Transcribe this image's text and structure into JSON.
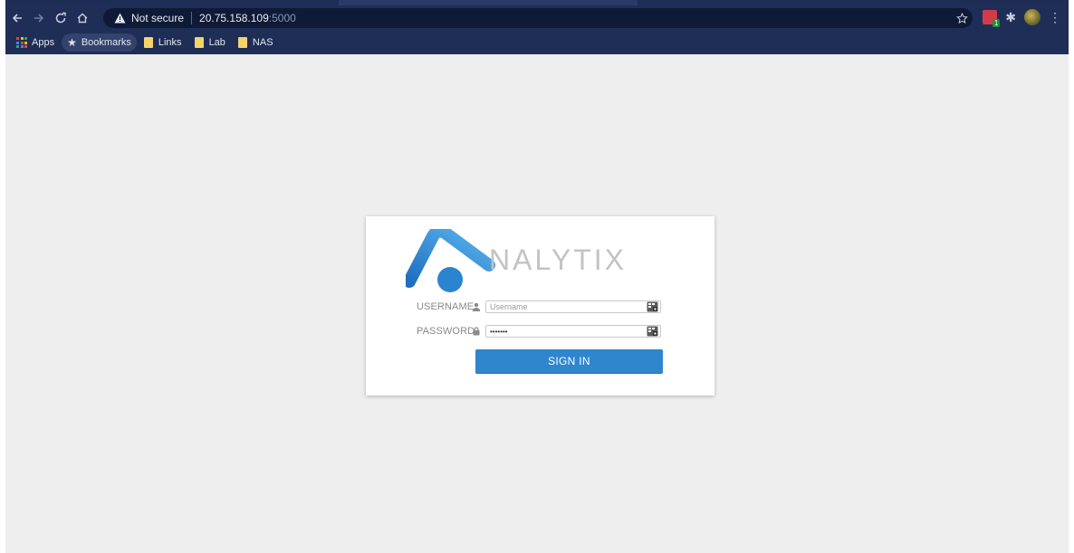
{
  "browser": {
    "security_label": "Not secure",
    "url_host": "20.75.158.109",
    "url_port": ":5000",
    "extension_badge_count": "1"
  },
  "bookmarks": [
    {
      "label": "Apps",
      "icon": "apps-grid-icon"
    },
    {
      "label": "Bookmarks",
      "icon": "star-icon"
    },
    {
      "label": "Links",
      "icon": "folder-icon"
    },
    {
      "label": "Lab",
      "icon": "folder-icon"
    },
    {
      "label": "NAS",
      "icon": "folder-icon"
    }
  ],
  "login": {
    "logo_text": "NALYTIX",
    "username_label": "USERNAME",
    "username_placeholder": "Username",
    "password_label": "PASSWORD",
    "password_value": "•••••••",
    "signin_label": "SIGN IN"
  },
  "colors": {
    "chrome_bg": "#1f2e57",
    "page_bg": "#eeeeee",
    "button_blue": "#2f86cd",
    "logo_gray": "#bfbfbf",
    "logo_blue": "#2f86cd"
  }
}
